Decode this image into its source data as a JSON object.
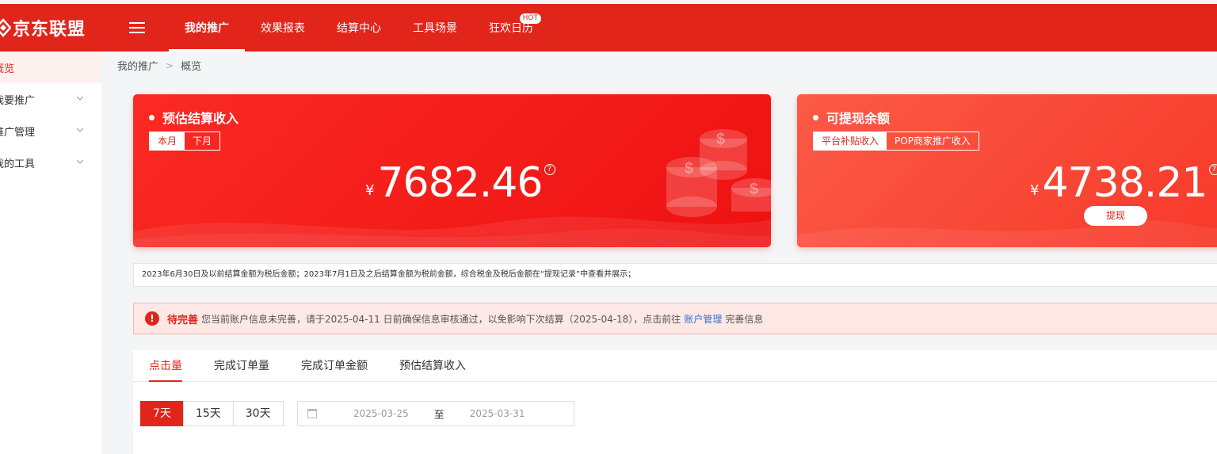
{
  "header": {
    "logo_text": "京东联盟",
    "nav": [
      {
        "label": "我的推广",
        "active": true
      },
      {
        "label": "效果报表"
      },
      {
        "label": "结算中心"
      },
      {
        "label": "工具场景"
      },
      {
        "label": "狂欢日历",
        "badge": "HOT"
      }
    ],
    "brand_color": "#e1251b"
  },
  "sidebar": {
    "items": [
      {
        "label": "概览",
        "active": true
      },
      {
        "label": "我要推广",
        "expandable": true
      },
      {
        "label": "推广管理",
        "expandable": true
      },
      {
        "label": "我的工具",
        "expandable": true
      }
    ]
  },
  "breadcrumb": {
    "items": [
      "我的推广",
      "概览"
    ]
  },
  "cards": {
    "estimated": {
      "title": "预估结算收入",
      "toggle": [
        "本月",
        "下月"
      ],
      "currency": "¥",
      "amount": "7682.46",
      "help": "?"
    },
    "withdrawable": {
      "title": "可提现余额",
      "toggle": [
        "平台补贴收入",
        "POP商家推广收入"
      ],
      "currency": "¥",
      "amount": "4738.21",
      "help": "?",
      "button": "提现"
    }
  },
  "notice": {
    "text": "2023年6月30日及以前结算金额为税后金额；2023年7月1日及之后结算金额为税前金额，综合税金及税后金额在“提现记录”中查看并展示；"
  },
  "alert": {
    "icon": "!",
    "tag": "待完善",
    "text_before": "您当前账户信息未完善，请于2025-04-11 日前确保信息审核通过，以免影响下次结算（2025-04-18），点击前往",
    "link": "账户管理",
    "text_after": "完善信息"
  },
  "metrics": {
    "tabs": [
      "点击量",
      "完成订单量",
      "完成订单金额",
      "预估结算收入"
    ],
    "ranges": [
      "7天",
      "15天",
      "30天"
    ],
    "date_start": "2025-03-25",
    "date_sep": "至",
    "date_end": "2025-03-31"
  }
}
